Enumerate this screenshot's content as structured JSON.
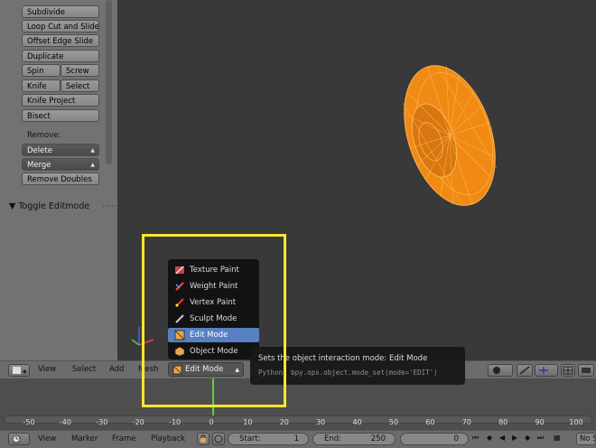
{
  "toolshelf": {
    "buttons": {
      "subdivide": "Subdivide",
      "loop_cut": "Loop Cut and Slide",
      "offset_edge": "Offset Edge Slide",
      "duplicate": "Duplicate",
      "spin": "Spin",
      "screw": "Screw",
      "knife": "Knife",
      "select": "Select",
      "knife_project": "Knife Project",
      "bisect": "Bisect"
    },
    "remove_label": "Remove:",
    "delete": "Delete",
    "merge": "Merge",
    "remove_doubles": "Remove Doubles",
    "toggle_editmode": "Toggle Editmode"
  },
  "header": {
    "menus": {
      "view": "View",
      "select": "Select",
      "add": "Add",
      "mesh": "Mesh"
    },
    "mode": "Edit Mode"
  },
  "mode_menu": {
    "items": [
      "Texture Paint",
      "Weight Paint",
      "Vertex Paint",
      "Sculpt Mode",
      "Edit Mode",
      "Object Mode"
    ],
    "selected": "Edit Mode"
  },
  "tooltip": {
    "text": "Sets the object interaction mode:  Edit Mode",
    "python": "Python: bpy.ops.object.mode_set(mode='EDIT')"
  },
  "timeline": {
    "ticks": [
      "-50",
      "-40",
      "-30",
      "-20",
      "-10",
      "0",
      "10",
      "20",
      "30",
      "40",
      "50",
      "60",
      "70",
      "80",
      "90",
      "100"
    ],
    "current_frame": 0
  },
  "bottombar": {
    "menus": {
      "view": "View",
      "marker": "Marker",
      "frame": "Frame",
      "playback": "Playback"
    },
    "start_label": "Start:",
    "start_value": "1",
    "end_label": "End:",
    "end_value": "250",
    "current_value": "0",
    "sync": "No S"
  },
  "colors": {
    "mesh": "#ff9a1f",
    "selection": "#5680c2",
    "highlight": "#f5e630",
    "frame_line": "#5fce3e"
  }
}
